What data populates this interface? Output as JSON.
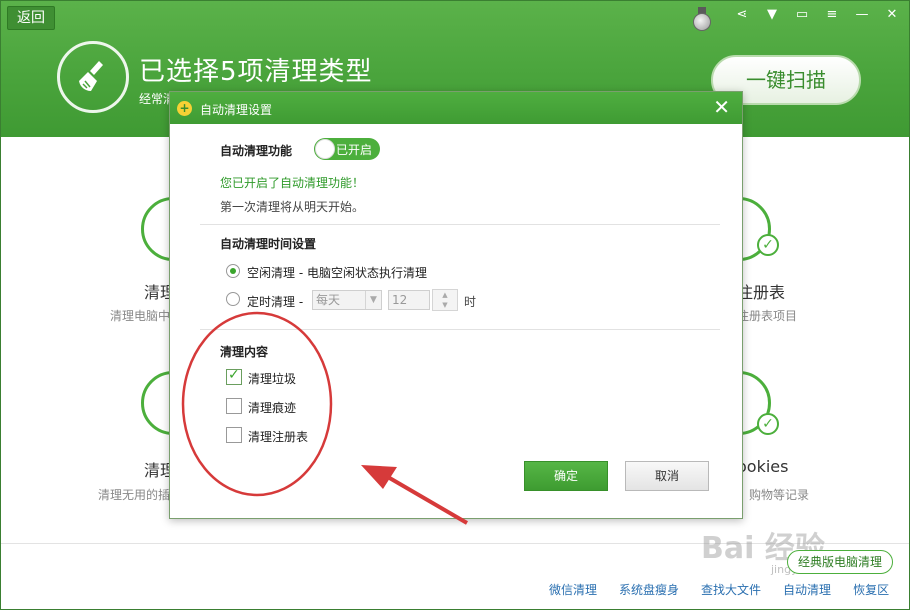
{
  "header": {
    "back_label": "返回",
    "title": "已选择5项清理类型",
    "subtitle_visible": "经常清",
    "scan_button": "一键扫描"
  },
  "categories": {
    "left_top": {
      "title": "清理",
      "desc": "清理电脑中"
    },
    "right_top": {
      "title": "注册表",
      "desc": "注册表项目"
    },
    "left_bottom": {
      "title": "清理",
      "desc": "清理无用的插"
    },
    "right_bottom": {
      "title": "ookies",
      "desc": "、购物等记录"
    }
  },
  "dialog": {
    "title": "自动清理设置",
    "auto_clean": {
      "label": "自动清理功能",
      "toggle_label": "已开启",
      "enabled_message": "您已开启了自动清理功能！",
      "first_run_message": "第一次清理将从明天开始。"
    },
    "schedule": {
      "label": "自动清理时间设置",
      "idle_option": "空闲清理 - 电脑空闲状态执行清理",
      "timed_option": "定时清理 -",
      "frequency_value": "每天",
      "hour_value": "12",
      "hour_unit": "时"
    },
    "content": {
      "label": "清理内容",
      "items": [
        {
          "label": "清理垃圾",
          "checked": true
        },
        {
          "label": "清理痕迹",
          "checked": false
        },
        {
          "label": "清理注册表",
          "checked": false
        }
      ]
    },
    "ok_label": "确定",
    "cancel_label": "取消"
  },
  "footer": {
    "legacy_button": "经典版电脑清理",
    "links": [
      "微信清理",
      "系统盘瘦身",
      "查找大文件",
      "自动清理",
      "恢复区"
    ]
  },
  "watermark": {
    "text": "Bai 经验",
    "sub": "jingyan.baidu.com"
  },
  "colors": {
    "brand_green": "#4caf3c",
    "annotation_red": "#d63a3a",
    "link_blue": "#2a6fb0"
  }
}
